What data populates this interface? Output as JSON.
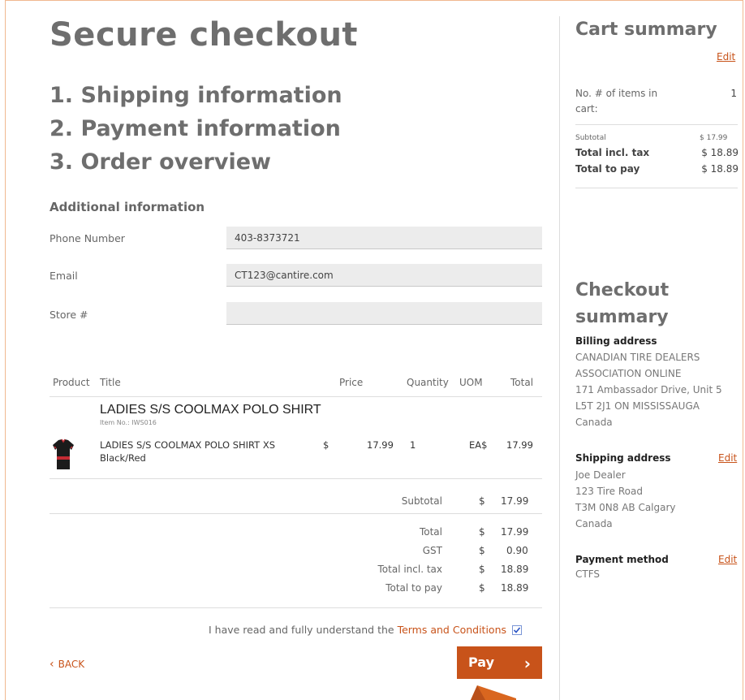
{
  "main": {
    "title": "Secure checkout",
    "steps": [
      "1. Shipping information",
      "2. Payment information",
      "3. Order overview"
    ],
    "additional_heading": "Additional information",
    "fields": [
      {
        "label": "Phone Number",
        "value": "403-8373721"
      },
      {
        "label": "Email",
        "value": "CT123@cantire.com"
      },
      {
        "label": "Store #",
        "value": ""
      }
    ]
  },
  "table": {
    "headers": {
      "product": "Product",
      "title": "Title",
      "price": "Price",
      "quantity": "Quantity",
      "uom": "UOM",
      "total": "Total"
    },
    "product_title": "LADIES S/S COOLMAX POLO SHIRT",
    "item_no": "Item No.: IWS016",
    "row": {
      "desc_line1": "LADIES S/S COOLMAX POLO SHIRT XS",
      "desc_line2": "Black/Red",
      "currency": "$",
      "price": "17.99",
      "quantity": "1",
      "uom": "EA$",
      "total": "17.99"
    },
    "subtotal": {
      "label": "Subtotal",
      "currency": "$",
      "value": "17.99"
    },
    "totals": [
      {
        "label": "Total",
        "currency": "$",
        "value": "17.99"
      },
      {
        "label": "GST",
        "currency": "$",
        "value": "0.90"
      },
      {
        "label": "Total incl. tax",
        "currency": "$",
        "value": "18.89"
      },
      {
        "label": "Total to pay",
        "currency": "$",
        "value": "18.89"
      }
    ]
  },
  "terms": {
    "prefix": "I have read and fully understand the ",
    "link": "Terms and Conditions",
    "checked": true
  },
  "actions": {
    "back_icon": "‹",
    "back_label": "BACK",
    "pay_label": "Pay",
    "pay_icon": "›"
  },
  "cart_summary": {
    "title": "Cart summary",
    "edit": "Edit",
    "items_label_line1": "No. # of items in",
    "items_label_line2": "cart:",
    "items_value": "1",
    "subtotal_label": "Subtotal",
    "subtotal_value": "$ 17.99",
    "total_tax_label": "Total incl. tax",
    "total_tax_value": "$ 18.89",
    "total_pay_label": "Total to pay",
    "total_pay_value": "$ 18.89"
  },
  "checkout_summary": {
    "title_line1": "Checkout",
    "title_line2": "summary",
    "billing_heading": "Billing address",
    "billing_lines": [
      "CANADIAN TIRE DEALERS",
      "ASSOCIATION ONLINE",
      "171 Ambassador Drive, Unit 5",
      "L5T 2J1 ON MISSISSAUGA",
      "Canada"
    ],
    "shipping_heading": "Shipping address",
    "shipping_edit": "Edit",
    "shipping_lines": [
      "Joe Dealer",
      "123 Tire Road",
      "T3M 0N8 AB Calgary",
      "Canada"
    ],
    "payment_heading": "Payment method",
    "payment_edit": "Edit",
    "payment_value": "CTFS"
  },
  "colors": {
    "accent": "#c8531a",
    "heading": "#6e6e6e",
    "input_bg": "#ececec"
  },
  "icons": [
    "back-chevron-icon",
    "pay-chevron-icon",
    "checkbox-check-icon",
    "product-thumbnail"
  ]
}
